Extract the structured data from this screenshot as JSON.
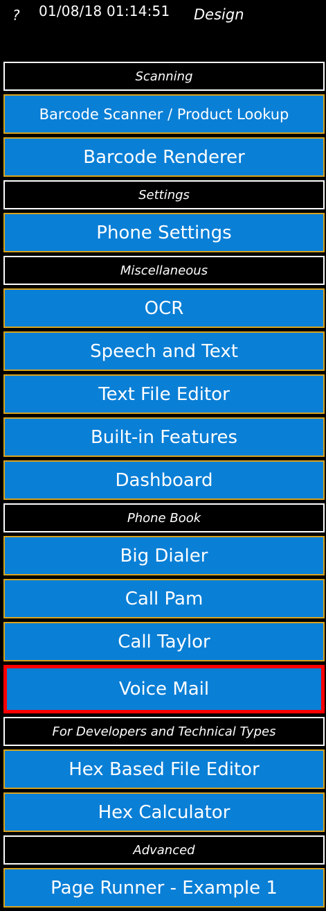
{
  "topbar": {
    "help": "?",
    "datetime": "01/08/18 01:14:51",
    "mode": "Design"
  },
  "sections": {
    "scanning": "Scanning",
    "settings": "Settings",
    "miscellaneous": "Miscellaneous",
    "phone_book": "Phone Book",
    "developers": "For Developers and Technical Types",
    "advanced": "Advanced"
  },
  "buttons": {
    "barcode_scanner": "Barcode Scanner / Product Lookup",
    "barcode_renderer": "Barcode Renderer",
    "phone_settings": "Phone Settings",
    "ocr": "OCR",
    "speech_text": "Speech and Text",
    "text_file_editor": "Text File Editor",
    "builtin_features": "Built-in Features",
    "dashboard": "Dashboard",
    "big_dialer": "Big Dialer",
    "call_pam": "Call Pam",
    "call_taylor": "Call Taylor",
    "voice_mail": "Voice Mail",
    "hex_file_editor": "Hex Based File Editor",
    "hex_calculator": "Hex Calculator",
    "page_runner": "Page Runner - Example 1"
  },
  "colors": {
    "button_bg": "#0a7fd6",
    "button_border": "#d9a31d",
    "selected_border": "#ff0000",
    "header_border": "#ffffff",
    "background": "#000000"
  }
}
